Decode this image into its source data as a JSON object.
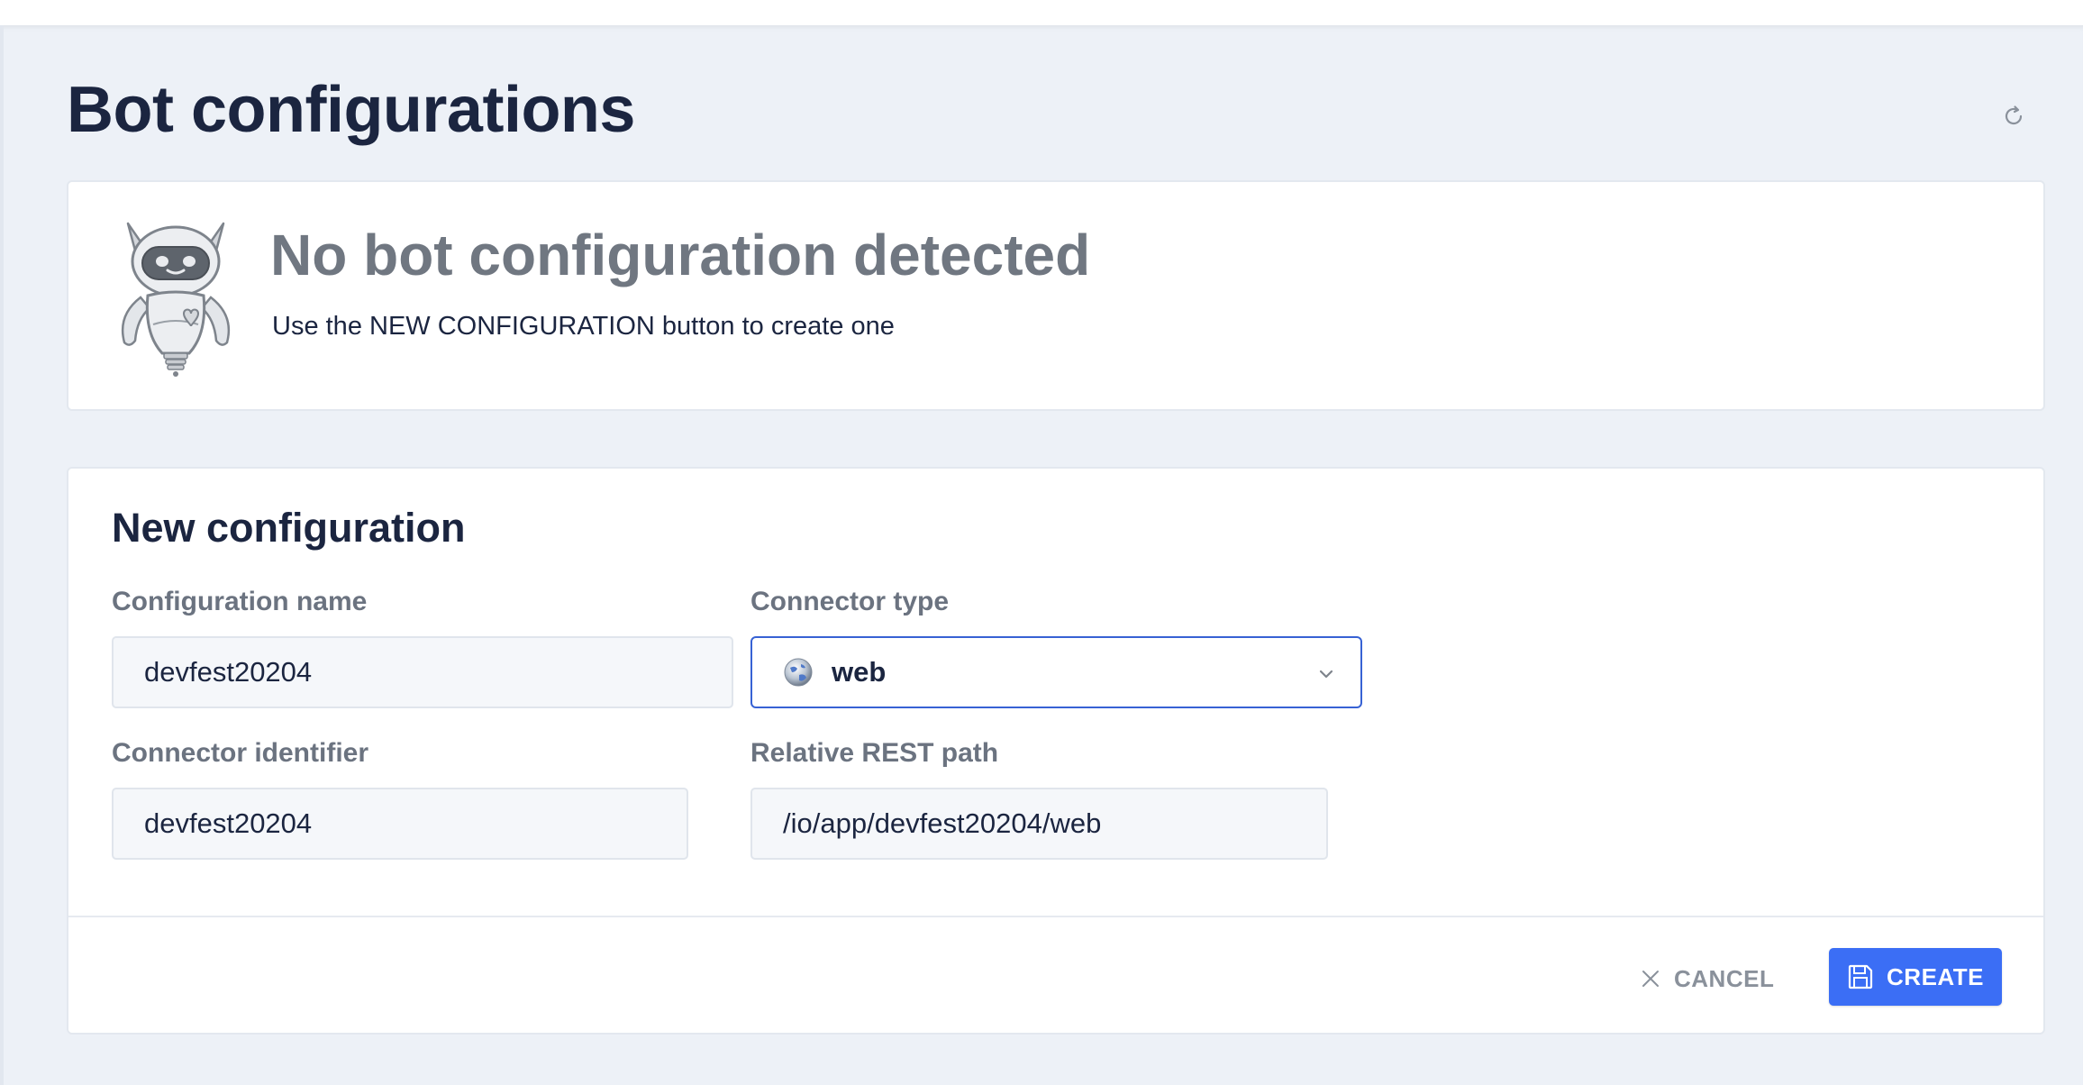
{
  "page": {
    "title": "Bot configurations"
  },
  "empty_state": {
    "title": "No bot configuration detected",
    "subtitle": "Use the NEW CONFIGURATION button to create one",
    "illustration_icon": "robot-mascot-icon"
  },
  "form": {
    "title": "New configuration",
    "fields": {
      "configuration_name": {
        "label": "Configuration name",
        "value": "devfest20204"
      },
      "connector_type": {
        "label": "Connector type",
        "value": "web",
        "icon": "globe-icon"
      },
      "connector_identifier": {
        "label": "Connector identifier",
        "value": "devfest20204"
      },
      "relative_rest_path": {
        "label": "Relative REST path",
        "value": "/io/app/devfest20204/web"
      }
    },
    "actions": {
      "cancel_label": "CANCEL",
      "create_label": "CREATE"
    }
  },
  "colors": {
    "accent": "#3b6ef5",
    "focus_border": "#3762d4",
    "background": "#edf1f7",
    "heading": "#1b2540",
    "muted": "#707781"
  }
}
